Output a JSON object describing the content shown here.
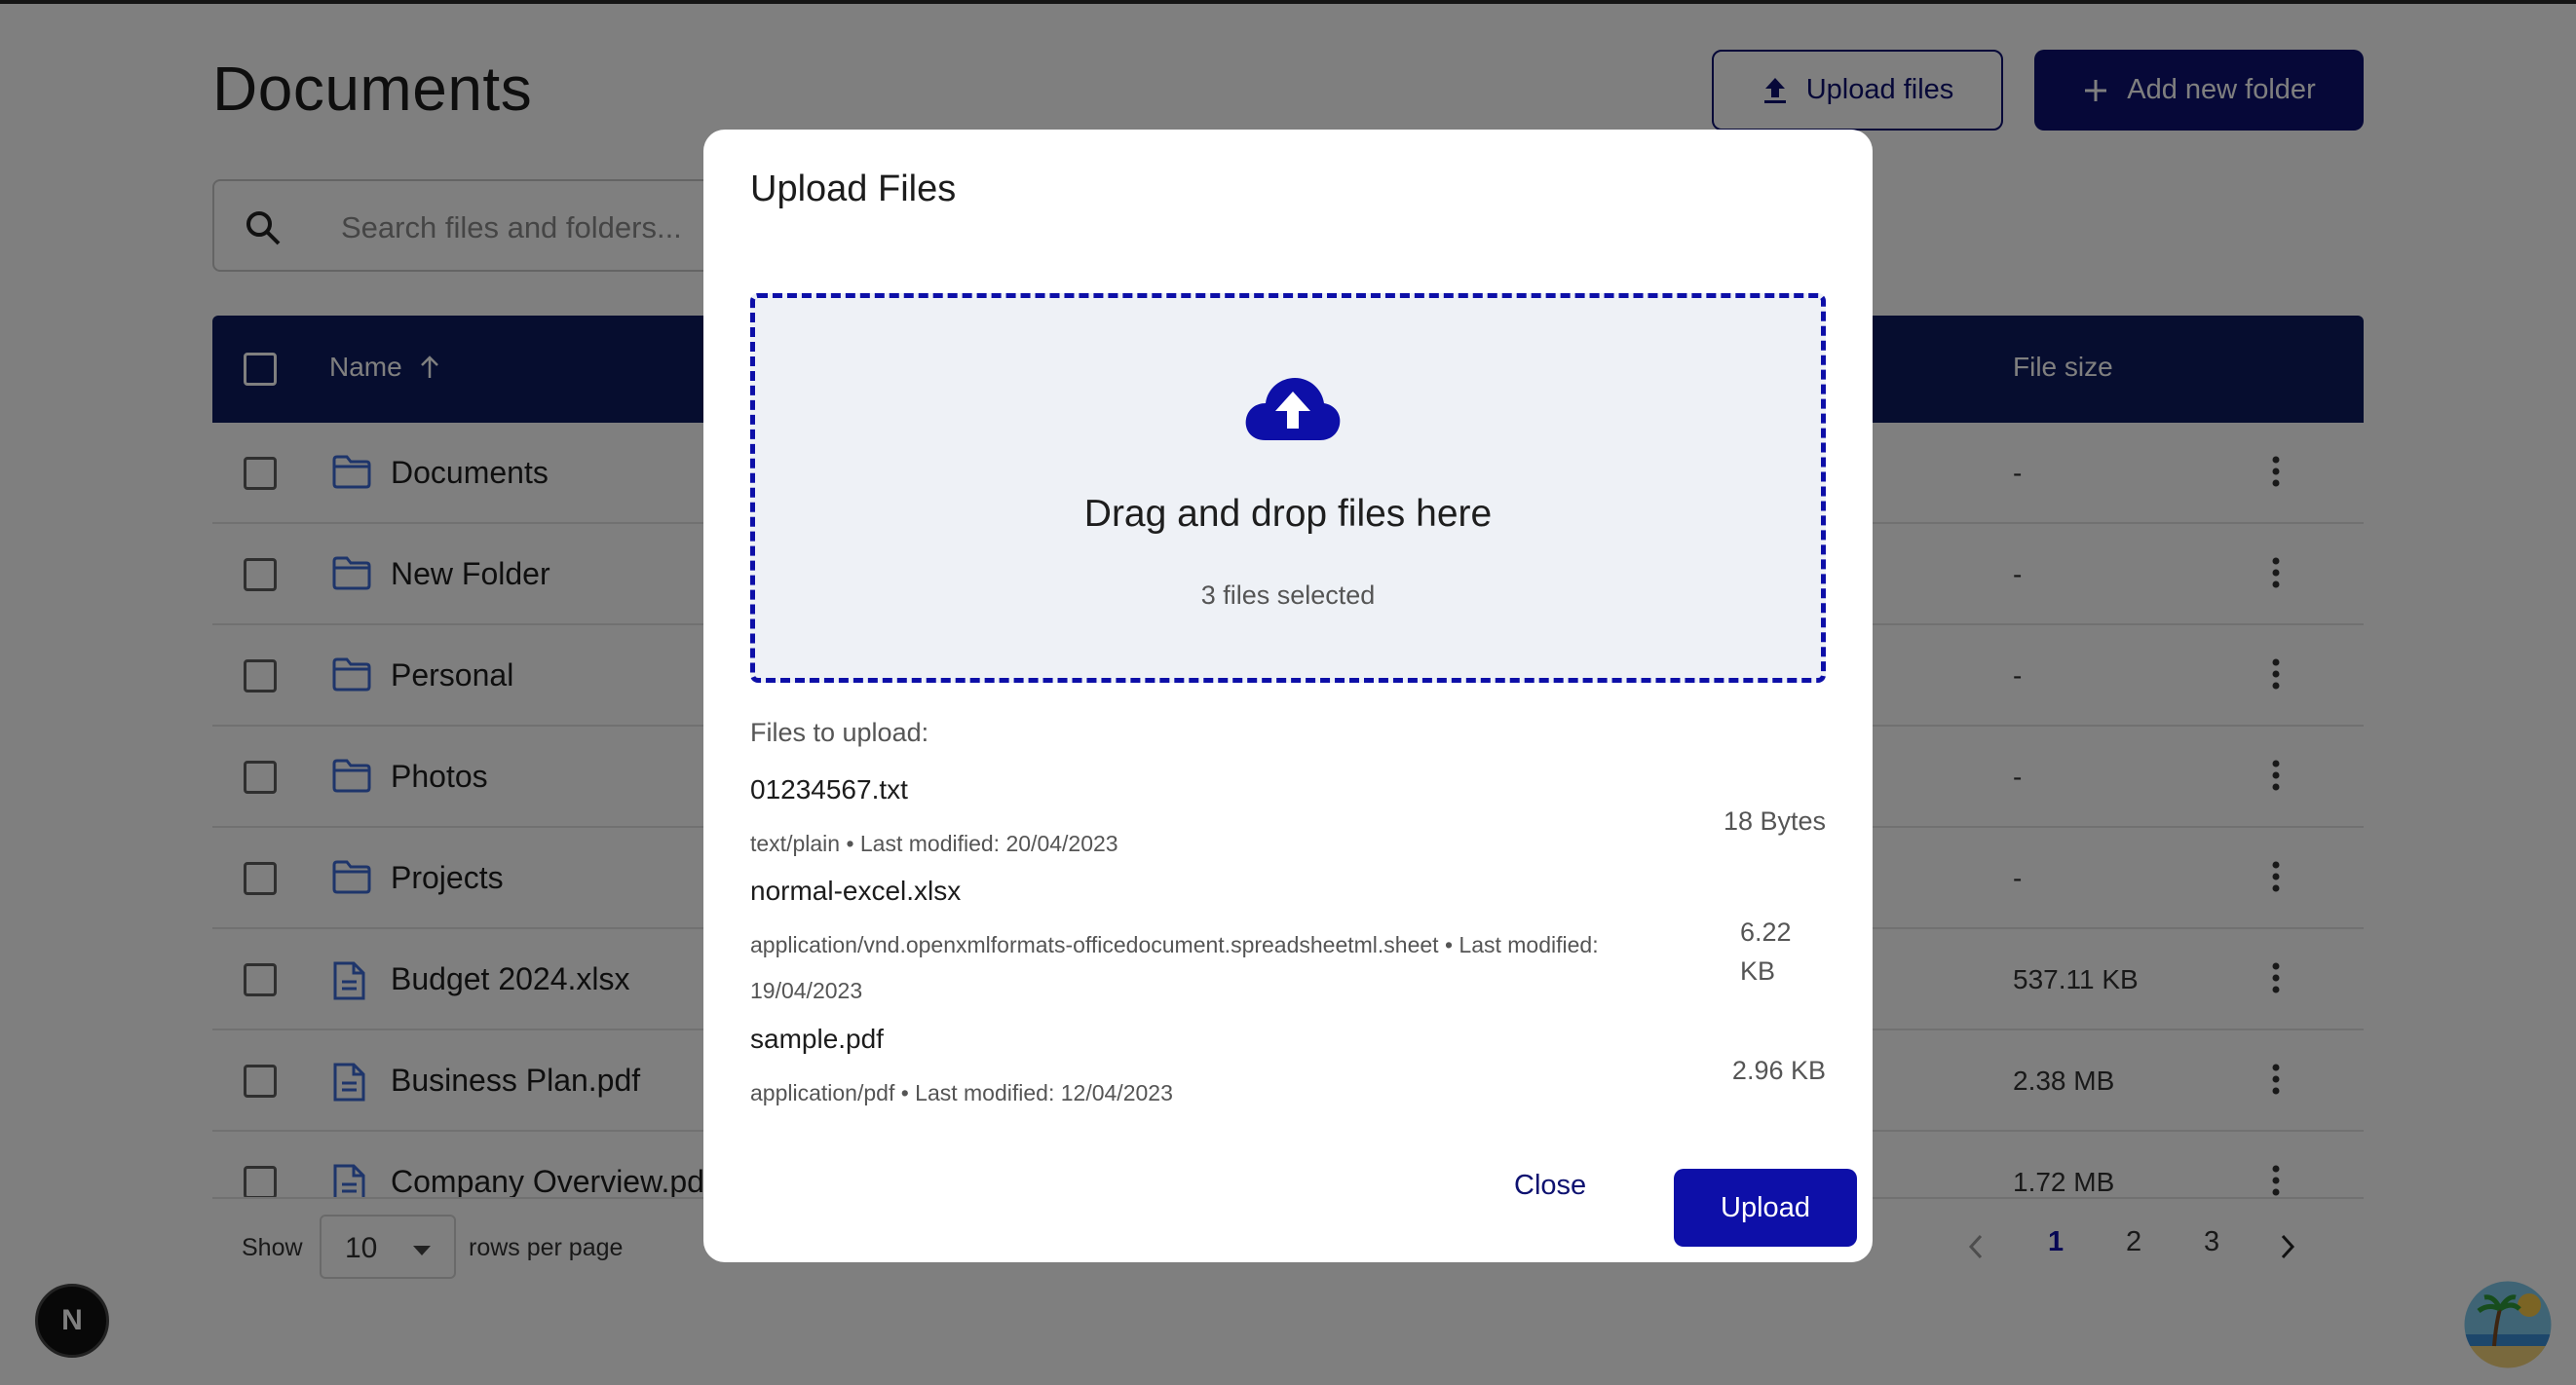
{
  "page": {
    "title": "Documents",
    "upload_files_label": "Upload files",
    "add_folder_label": "Add new folder",
    "search_placeholder": "Search files and folders...",
    "table": {
      "col_name": "Name",
      "col_size": "File size",
      "rows": [
        {
          "name": "Documents",
          "type": "folder",
          "size": "-"
        },
        {
          "name": "New Folder",
          "type": "folder",
          "size": "-"
        },
        {
          "name": "Personal",
          "type": "folder",
          "size": "-"
        },
        {
          "name": "Photos",
          "type": "folder",
          "size": "-"
        },
        {
          "name": "Projects",
          "type": "folder",
          "size": "-"
        },
        {
          "name": "Budget 2024.xlsx",
          "type": "file",
          "size": "537.11 KB"
        },
        {
          "name": "Business Plan.pdf",
          "type": "file",
          "size": "2.38 MB"
        },
        {
          "name": "Company Overview.pd",
          "type": "file",
          "size": "1.72 MB"
        }
      ]
    },
    "footer": {
      "show_label": "Show",
      "rows_value": "10",
      "rows_per_page_label": "rows per page",
      "pages": [
        "1",
        "2",
        "3"
      ],
      "current_page": "1"
    },
    "badge_letter": "N"
  },
  "modal": {
    "title": "Upload Files",
    "dropzone_title": "Drag and drop files here",
    "dropzone_count": "3 files selected",
    "list_heading": "Files to upload:",
    "files": [
      {
        "name": "01234567.txt",
        "meta": "text/plain • Last modified: 20/04/2023",
        "size": "18 Bytes"
      },
      {
        "name": "normal-excel.xlsx",
        "meta": "application/vnd.openxmlformats-officedocument.spreadsheetml.sheet • Last modified: 19/04/2023",
        "size": "6.22 KB"
      },
      {
        "name": "sample.pdf",
        "meta": "application/pdf • Last modified: 12/04/2023",
        "size": "2.96 KB"
      }
    ],
    "close_label": "Close",
    "upload_label": "Upload"
  },
  "colors": {
    "primary": "#0d1170",
    "dropzone_border": "#0d0fa8",
    "header_bg": "#0d1b5e",
    "folder_icon": "#3d6ad6"
  },
  "icons": [
    "upload-icon",
    "plus-icon",
    "search-icon",
    "sort-arrow-up-icon",
    "folder-icon",
    "file-icon",
    "more-vertical-icon",
    "chevron-down-icon",
    "chevron-left-icon",
    "chevron-right-icon",
    "cloud-upload-icon"
  ]
}
